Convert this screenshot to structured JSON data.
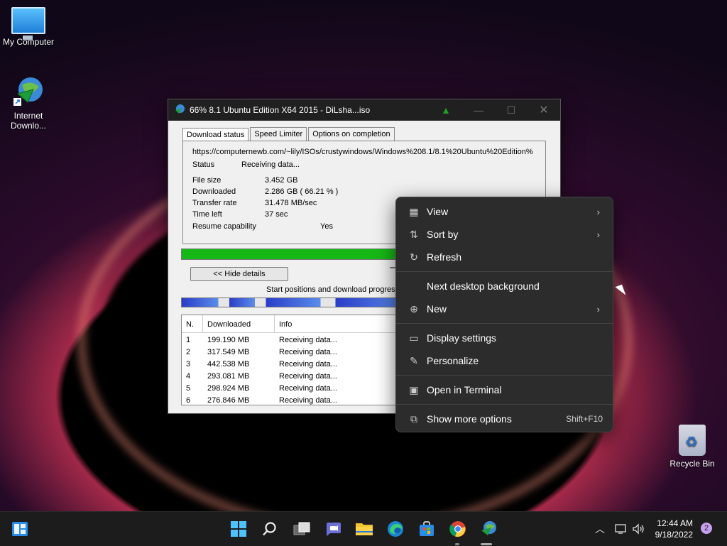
{
  "desktop": {
    "icons": [
      {
        "label": "My Computer"
      },
      {
        "label": "Internet\nDownlo..."
      },
      {
        "label": "Recycle Bin"
      }
    ]
  },
  "idm": {
    "title": "66% 8.1 Ubuntu Edition X64 2015 - DiLsha...iso",
    "tabs": [
      "Download status",
      "Speed Limiter",
      "Options on completion"
    ],
    "url": "https://computernewb.com/~lily/ISOs/crustywindows/Windows%208.1/8.1%20Ubuntu%20Edition%",
    "status_label": "Status",
    "status_value": "Receiving data...",
    "file_size_label": "File size",
    "file_size_value": "3.452  GB",
    "downloaded_label": "Downloaded",
    "downloaded_value": "2.286  GB  ( 66.21 % )",
    "transfer_label": "Transfer rate",
    "transfer_value": "31.478  MB/sec",
    "time_left_label": "Time left",
    "time_left_value": "37 sec",
    "resume_label": "Resume capability",
    "resume_value": "Yes",
    "progress": 0.6621,
    "hide_details": "<< Hide details",
    "start_positions": "Start positions and download progress",
    "columns": [
      "N.",
      "Downloaded",
      "Info"
    ],
    "rows": [
      {
        "n": "1",
        "downloaded": "199.190  MB",
        "info": "Receiving data..."
      },
      {
        "n": "2",
        "downloaded": "317.549  MB",
        "info": "Receiving data..."
      },
      {
        "n": "3",
        "downloaded": "442.538  MB",
        "info": "Receiving data..."
      },
      {
        "n": "4",
        "downloaded": "293.081  MB",
        "info": "Receiving data..."
      },
      {
        "n": "5",
        "downloaded": "298.924  MB",
        "info": "Receiving data..."
      },
      {
        "n": "6",
        "downloaded": "276.846  MB",
        "info": "Receiving data..."
      }
    ]
  },
  "context_menu": {
    "items": [
      {
        "label": "View",
        "icon": "grid-icon",
        "submenu": true
      },
      {
        "label": "Sort by",
        "icon": "sort-icon",
        "submenu": true
      },
      {
        "label": "Refresh",
        "icon": "refresh-icon",
        "submenu": false
      },
      {
        "label": "Next desktop background",
        "icon": "",
        "submenu": false
      },
      {
        "label": "New",
        "icon": "plus-circle-icon",
        "submenu": true
      },
      {
        "label": "Display settings",
        "icon": "display-icon",
        "submenu": false
      },
      {
        "label": "Personalize",
        "icon": "brush-icon",
        "submenu": false
      },
      {
        "label": "Open in Terminal",
        "icon": "terminal-icon",
        "submenu": false
      },
      {
        "label": "Show more options",
        "icon": "more-options-icon",
        "submenu": false,
        "shortcut": "Shift+F10"
      }
    ]
  },
  "taskbar": {
    "time": "12:44 AM",
    "date": "9/18/2022",
    "notifications": "2"
  },
  "colors": {
    "progress_fill": "#16b816",
    "menu_bg": "#2c2c2c",
    "taskbar_bg": "#1c1c1c"
  }
}
